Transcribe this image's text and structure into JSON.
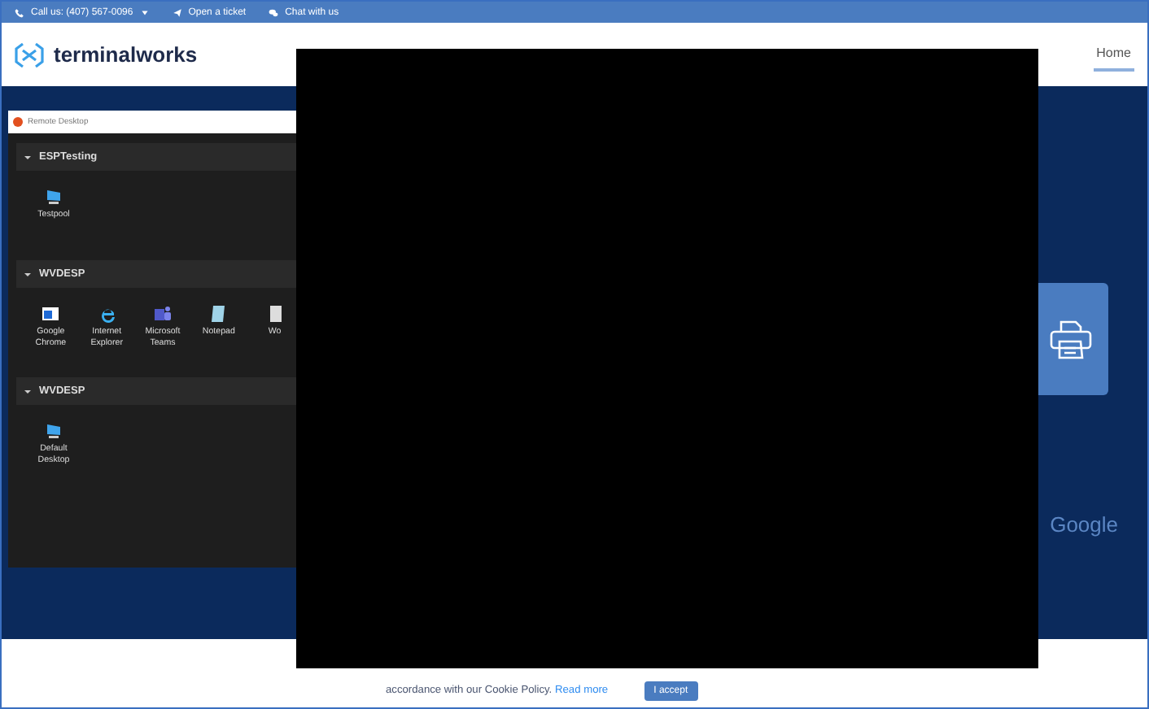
{
  "top_bar": {
    "items": [
      {
        "kind": "phone",
        "label": "Call us: (407) 567-0096"
      },
      {
        "kind": "ticket",
        "label": "Open a ticket"
      },
      {
        "kind": "chat",
        "label": "Chat with us"
      }
    ]
  },
  "header": {
    "logo": "terminalworks",
    "nav": [
      {
        "label": "Home",
        "selected": true
      }
    ]
  },
  "remote_desktop": {
    "title": "Remote Desktop",
    "groups": [
      {
        "name": "ESPTesting",
        "expanded": true,
        "apps": [
          {
            "kind": "desktop",
            "label": "Testpool"
          }
        ]
      },
      {
        "name": "WVDESP",
        "expanded": true,
        "apps": [
          {
            "kind": "chrome",
            "label": "Google Chrome"
          },
          {
            "kind": "ie",
            "label": "Internet Explorer"
          },
          {
            "kind": "teams",
            "label": "Microsoft Teams"
          },
          {
            "kind": "notepad",
            "label": "Notepad"
          },
          {
            "kind": "word",
            "label": "Wo"
          }
        ]
      },
      {
        "name": "WVDESP",
        "expanded": true,
        "apps": [
          {
            "kind": "desktop",
            "label": "Default Desktop"
          }
        ]
      }
    ]
  },
  "hero": {
    "partner": "Google"
  },
  "cookie_bar": {
    "text": "accordance with our Cookie Policy.",
    "link": "Read more",
    "button": "I accept"
  }
}
